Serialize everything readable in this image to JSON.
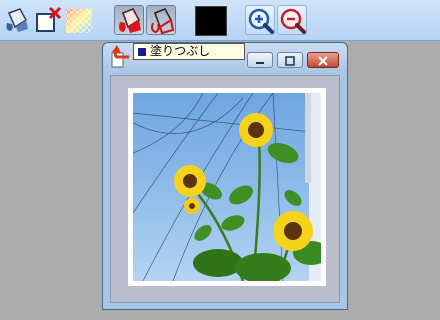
{
  "toolbar": {
    "buttons": [
      {
        "name": "paint-fill-tool-button",
        "icon": "paint-bucket-icon"
      },
      {
        "name": "clear-image-button",
        "icon": "frame-delete-icon"
      },
      {
        "name": "transparency-button",
        "icon": "checkerboard-icon"
      },
      {
        "name": "fill-mode-button",
        "icon": "red-paint-bucket-icon"
      },
      {
        "name": "fill-outline-button",
        "icon": "outline-paint-icon"
      },
      {
        "name": "zoom-in-button",
        "icon": "zoom-in-icon"
      },
      {
        "name": "zoom-out-button",
        "icon": "zoom-out-icon"
      }
    ],
    "current_color": "#000000"
  },
  "tooltip": {
    "label": "塗りつぶし"
  },
  "image_window": {
    "title": "",
    "controls": [
      "minimize",
      "maximize",
      "close"
    ]
  },
  "colors": {
    "toolbar_bg": "#c4dcf6",
    "workspace_bg": "#ababab",
    "tooltip_bg": "#ffffe6",
    "close_button": "#c24732"
  }
}
